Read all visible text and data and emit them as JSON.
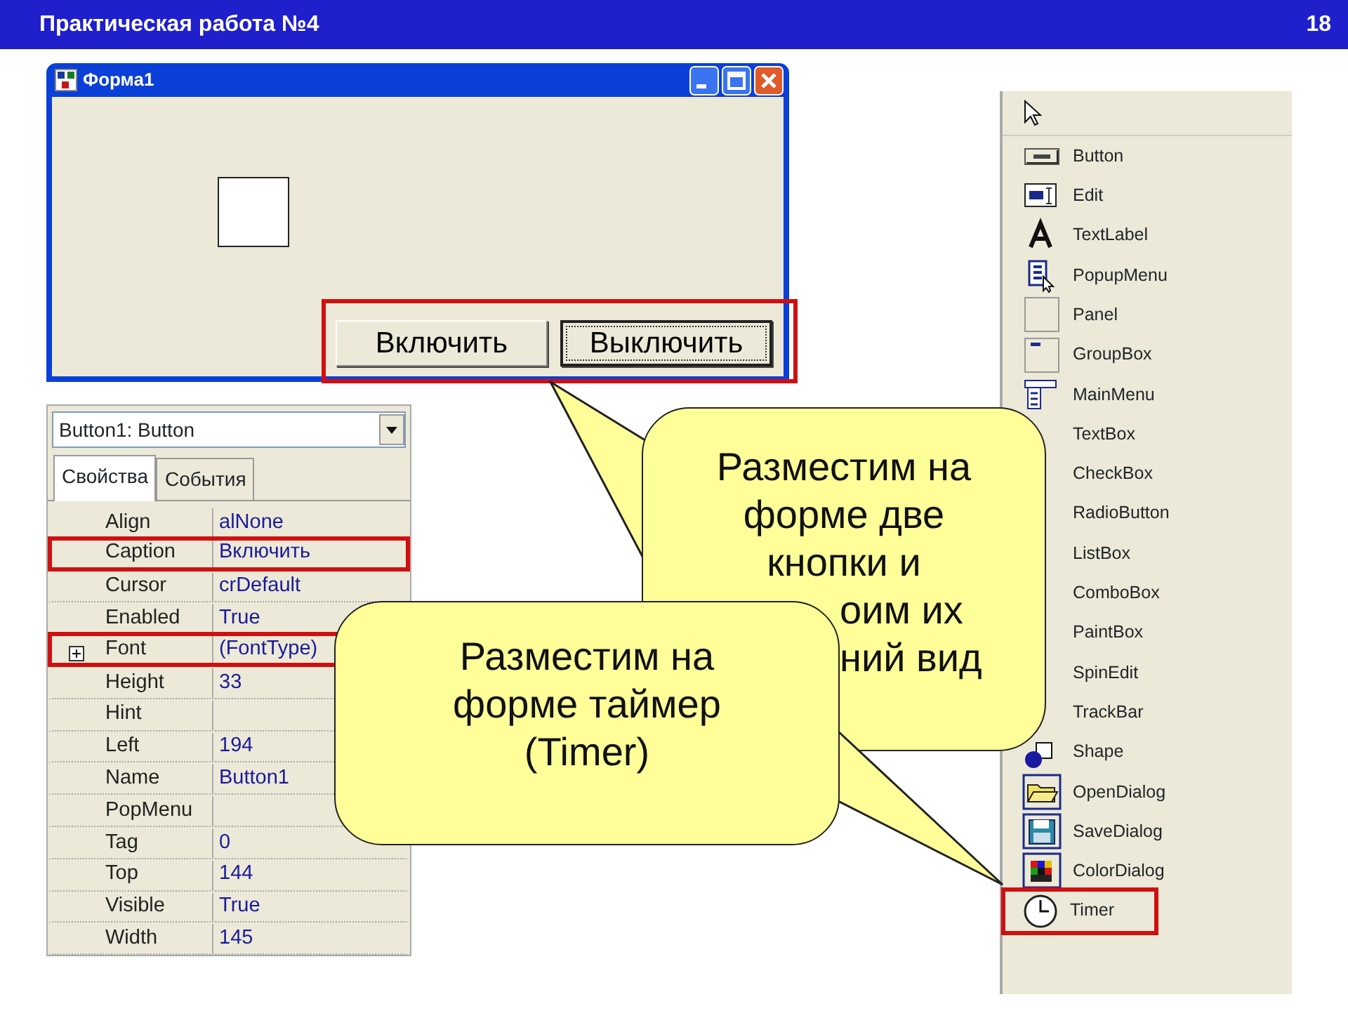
{
  "slide": {
    "title": "Практическая работа №4",
    "page": "18"
  },
  "form_window": {
    "title": "Форма1",
    "buttons_highlighted": true,
    "buttons": [
      {
        "label": "Включить",
        "focused": false
      },
      {
        "label": "Выключить",
        "focused": true
      }
    ]
  },
  "inspector": {
    "object": "Button1: Button",
    "tabs": [
      {
        "label": "Свойства",
        "selected": true
      },
      {
        "label": "События",
        "selected": false
      }
    ],
    "properties": [
      {
        "name": "Align",
        "value": "alNone",
        "highlighted": false
      },
      {
        "name": "Caption",
        "value": "Включить",
        "highlighted": true
      },
      {
        "name": "Cursor",
        "value": "crDefault",
        "highlighted": false
      },
      {
        "name": "Enabled",
        "value": "True",
        "highlighted": false
      },
      {
        "name": "Font",
        "value": "(FontType)",
        "highlighted": true,
        "expandable": true
      },
      {
        "name": "Height",
        "value": "33",
        "highlighted": false
      },
      {
        "name": "Hint",
        "highlighted": false
      },
      {
        "name": "Left",
        "value": "194",
        "highlighted": false
      },
      {
        "name": "Name",
        "value": "Button1",
        "highlighted": false
      },
      {
        "name": "PopMenu",
        "highlighted": false
      },
      {
        "name": "Tag",
        "value": "0",
        "highlighted": false
      },
      {
        "name": "Top",
        "value": "144",
        "highlighted": false
      },
      {
        "name": "Visible",
        "value": "True",
        "highlighted": false
      },
      {
        "name": "Width",
        "value": "145",
        "highlighted": false
      }
    ]
  },
  "palette": {
    "items": [
      {
        "label": "Button",
        "highlighted": false
      },
      {
        "label": "Edit",
        "highlighted": false
      },
      {
        "label": "TextLabel",
        "highlighted": false
      },
      {
        "label": "PopupMenu",
        "highlighted": false
      },
      {
        "label": "Panel",
        "highlighted": false
      },
      {
        "label": "GroupBox",
        "highlighted": false
      },
      {
        "label": "MainMenu",
        "highlighted": false
      },
      {
        "label": "TextBox",
        "highlighted": false
      },
      {
        "label": "CheckBox",
        "highlighted": false
      },
      {
        "label": "RadioButton",
        "highlighted": false
      },
      {
        "label": "ListBox",
        "highlighted": false
      },
      {
        "label": "ComboBox",
        "highlighted": false
      },
      {
        "label": "PaintBox",
        "highlighted": false
      },
      {
        "label": "SpinEdit",
        "highlighted": false
      },
      {
        "label": "TrackBar",
        "highlighted": false
      },
      {
        "label": "Shape",
        "highlighted": false
      },
      {
        "label": "OpenDialog",
        "highlighted": false
      },
      {
        "label": "SaveDialog",
        "highlighted": false
      },
      {
        "label": "ColorDialog",
        "highlighted": false
      },
      {
        "label": "Timer",
        "highlighted": true
      }
    ]
  },
  "callouts": [
    {
      "lines": [
        "Разместим на",
        "форме две",
        "кнопки и",
        "оим их",
        "ний вид"
      ]
    },
    {
      "text": "Разместим на форме таймер (Timer)"
    }
  ]
}
